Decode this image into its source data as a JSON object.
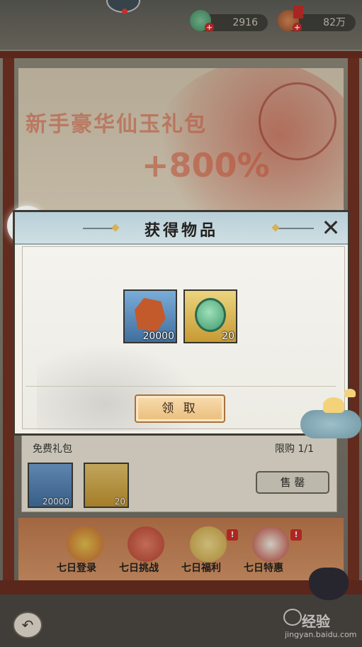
{
  "header": {
    "resources": [
      {
        "name": "jade",
        "value": "2916"
      },
      {
        "name": "coin",
        "value": "82万"
      }
    ],
    "plus_glyph": "+"
  },
  "banner": {
    "title": "新手豪华仙玉礼包",
    "bonus": "+800%"
  },
  "dialog": {
    "title": "获得物品",
    "close_glyph": "✕",
    "rewards": [
      {
        "item": "ore",
        "qty": "20000"
      },
      {
        "item": "jade",
        "qty": "20"
      }
    ],
    "claim_label": "领 取"
  },
  "package": {
    "name": "免费礼包",
    "limit": "限购 1/1",
    "items": [
      {
        "item": "ore",
        "qty": "20000"
      },
      {
        "item": "jade",
        "qty": "20"
      }
    ],
    "sell_label": "售 罄"
  },
  "activities": [
    {
      "label": "七日登录",
      "badge": ""
    },
    {
      "label": "七日挑战",
      "badge": ""
    },
    {
      "label": "七日福利",
      "badge": "!"
    },
    {
      "label": "七日特惠",
      "badge": "!"
    }
  ],
  "footer": {
    "back_glyph": "↶",
    "watermark_main": "经验",
    "watermark_url": "jingyan.baidu.com"
  },
  "colors": {
    "frame": "#6b2a1d",
    "accent_red": "#c92a28",
    "claim_button": "#ebbd7a",
    "dialog_header": "#b8cfd8"
  }
}
